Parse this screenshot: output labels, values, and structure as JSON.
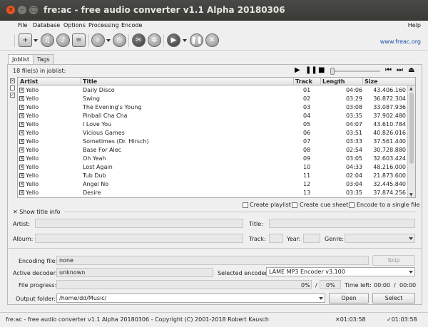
{
  "window": {
    "title": "fre:ac - free audio converter v1.1 Alpha 20180306",
    "close": "×",
    "minimize": "–",
    "maximize": "□"
  },
  "menu": {
    "items": [
      "File",
      "Database",
      "Options",
      "Processing",
      "Encode"
    ],
    "help": "Help"
  },
  "toolbar": {
    "homepage_link": "www.freac.org"
  },
  "tabs": [
    "Joblist",
    "Tags"
  ],
  "joblist": {
    "file_count": "18 file(s) in joblist:",
    "columns": [
      "Artist",
      "Title",
      "Track",
      "Length",
      "Size"
    ],
    "rows": [
      [
        "Yello",
        "Daily Disco",
        "01",
        "04:06",
        "43.406.160"
      ],
      [
        "Yello",
        "Swing",
        "02",
        "03:29",
        "36.872.304"
      ],
      [
        "Yello",
        "The Evening's Young",
        "03",
        "03:08",
        "33.087.936"
      ],
      [
        "Yello",
        "Pinball Cha Cha",
        "04",
        "03:35",
        "37.902.480"
      ],
      [
        "Yello",
        "I Love You",
        "05",
        "04:07",
        "43.610.784"
      ],
      [
        "Yello",
        "Vicious Games",
        "06",
        "03:51",
        "40.826.016"
      ],
      [
        "Yello",
        "Sometimes (Dr. Hirsch)",
        "07",
        "03:33",
        "37.561.440"
      ],
      [
        "Yello",
        "Base For Alec",
        "08",
        "02:54",
        "30.728.880"
      ],
      [
        "Yello",
        "Oh Yeah",
        "09",
        "03:05",
        "32.603.424"
      ],
      [
        "Yello",
        "Lost Again",
        "10",
        "04:33",
        "48.216.000"
      ],
      [
        "Yello",
        "Tub Dub",
        "11",
        "02:04",
        "21.873.600"
      ],
      [
        "Yello",
        "Angel No",
        "12",
        "03:04",
        "32.445.840"
      ],
      [
        "Yello",
        "Desire",
        "13",
        "03:35",
        "37.874.256"
      ]
    ]
  },
  "options": {
    "create_playlist": "Create playlist",
    "create_cue_sheet": "Create cue sheet",
    "encode_single_file": "Encode to a single file"
  },
  "title_info": {
    "toggle_label": "Show title info",
    "artist_label": "Artist:",
    "title_label": "Title:",
    "album_label": "Album:",
    "track_label": "Track:",
    "year_label": "Year:",
    "genre_label": "Genre:"
  },
  "encoding": {
    "encoding_file_label": "Encoding file:",
    "encoding_file_value": "none",
    "skip_button": "Skip",
    "active_decoder_label": "Active decoder:",
    "active_decoder_value": "unknown",
    "selected_encoder_label": "Selected encoder:",
    "selected_encoder_value": "LAME MP3 Encoder v3.100",
    "file_progress_label": "File progress:",
    "file_progress_pct": "0%",
    "total_progress_pct": "0%",
    "progress_sep": "/",
    "time_left_label": "Time left:",
    "time_left_value": "00:00",
    "time_left_total": "00:00",
    "output_folder_label": "Output folder:",
    "output_folder_value": "/home/dd/Music/",
    "open_button": "Open",
    "select_button": "Select"
  },
  "status": {
    "text": "fre:ac - free audio converter v1.1 Alpha 20180306 - Copyright (C) 2001-2018 Robert Kausch",
    "selected_time": "01:03:58",
    "total_time": "01:03:58"
  }
}
